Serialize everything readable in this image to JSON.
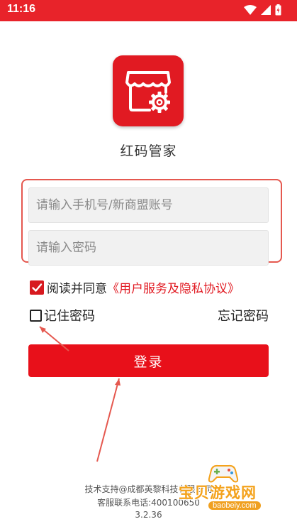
{
  "status_bar": {
    "time": "11:16",
    "wifi_icon": "wifi-icon",
    "signal_icon": "signal-icon",
    "battery_icon": "battery-charging-icon"
  },
  "brand": {
    "logo_icon": "store-gear-icon",
    "app_name": "红码管家"
  },
  "login_form": {
    "account_placeholder": "请输入手机号/新商盟账号",
    "password_placeholder": "请输入密码"
  },
  "agreement": {
    "checked": true,
    "text": "阅读并同意",
    "link": "《用户服务及隐私协议》"
  },
  "remember": {
    "checked": false,
    "label": "记住密码"
  },
  "forgot_label": "忘记密码",
  "login_button": "登录",
  "footer": {
    "support": "技术支持@成都英黎科技有限公司",
    "service_phone": "客服联系电话:400100650",
    "version": "3.2.36"
  },
  "watermark": {
    "name": "宝贝游戏网",
    "url": "baobeiy.com"
  },
  "colors": {
    "brand_red": "#e8232a",
    "button_red": "#e8101a",
    "annotation_red": "#e5584f",
    "watermark_orange": "#f4a21b"
  }
}
